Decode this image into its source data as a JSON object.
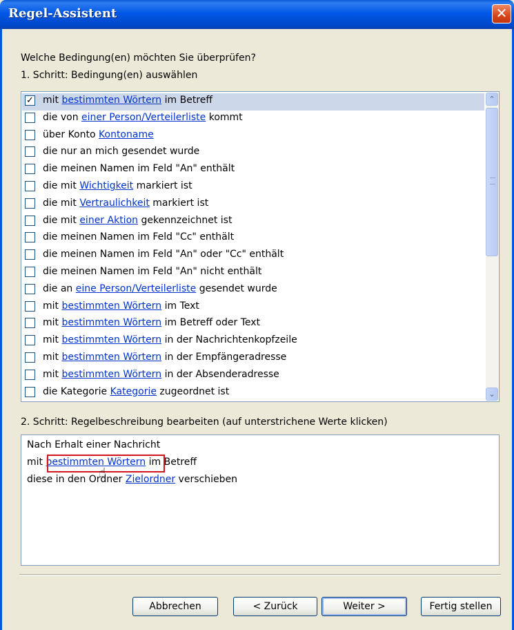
{
  "window": {
    "title": "Regel-Assistent",
    "close_glyph": "✕"
  },
  "question": "Welche Bedingung(en) möchten Sie überprüfen?",
  "step1_label": "1. Schritt: Bedingung(en) auswählen",
  "conditions": [
    {
      "checked": true,
      "pre": "mit ",
      "link": "bestimmten Wörtern",
      "post": " im Betreff"
    },
    {
      "checked": false,
      "pre": "die von ",
      "link": "einer Person/Verteilerliste",
      "post": " kommt"
    },
    {
      "checked": false,
      "pre": "über Konto ",
      "link": "Kontoname",
      "post": ""
    },
    {
      "checked": false,
      "pre": "die nur an mich gesendet wurde",
      "link": "",
      "post": ""
    },
    {
      "checked": false,
      "pre": "die meinen Namen im Feld \"An\" enthält",
      "link": "",
      "post": ""
    },
    {
      "checked": false,
      "pre": "die mit ",
      "link": "Wichtigkeit",
      "post": " markiert ist"
    },
    {
      "checked": false,
      "pre": "die mit ",
      "link": "Vertraulichkeit",
      "post": " markiert ist"
    },
    {
      "checked": false,
      "pre": "die mit ",
      "link": "einer Aktion",
      "post": " gekennzeichnet ist"
    },
    {
      "checked": false,
      "pre": "die meinen Namen im Feld \"Cc\" enthält",
      "link": "",
      "post": ""
    },
    {
      "checked": false,
      "pre": "die meinen Namen im Feld \"An\" oder \"Cc\" enthält",
      "link": "",
      "post": ""
    },
    {
      "checked": false,
      "pre": "die meinen Namen im Feld \"An\" nicht enthält",
      "link": "",
      "post": ""
    },
    {
      "checked": false,
      "pre": "die an ",
      "link": "eine Person/Verteilerliste",
      "post": " gesendet wurde"
    },
    {
      "checked": false,
      "pre": "mit ",
      "link": "bestimmten Wörtern",
      "post": " im Text"
    },
    {
      "checked": false,
      "pre": "mit ",
      "link": "bestimmten Wörtern",
      "post": " im Betreff oder Text"
    },
    {
      "checked": false,
      "pre": "mit ",
      "link": "bestimmten Wörtern",
      "post": " in der Nachrichtenkopfzeile"
    },
    {
      "checked": false,
      "pre": "mit ",
      "link": "bestimmten Wörtern",
      "post": " in der Empfängeradresse"
    },
    {
      "checked": false,
      "pre": "mit ",
      "link": "bestimmten Wörtern",
      "post": " in der Absenderadresse"
    },
    {
      "checked": false,
      "pre": "die Kategorie ",
      "link": "Kategorie",
      "post": " zugeordnet ist"
    }
  ],
  "step2_label": "2. Schritt: Regelbeschreibung bearbeiten (auf unterstrichene Werte klicken)",
  "description": {
    "line1": "Nach Erhalt einer Nachricht",
    "line2_pre": "mit ",
    "line2_link": "bestimmten Wörtern",
    "line2_post": " im Betreff",
    "line3_pre": "diese in den Ordner ",
    "line3_link": "Zielordner",
    "line3_post": " verschieben"
  },
  "buttons": {
    "cancel": "Abbrechen",
    "back": "< Zurück",
    "next": "Weiter >",
    "finish": "Fertig stellen"
  },
  "scrollbar": {
    "up_glyph": "⌃",
    "down_glyph": "⌄"
  },
  "colors": {
    "title_bar": "#0058e6",
    "link": "#0033cc",
    "highlight_box": "#d4141d"
  }
}
